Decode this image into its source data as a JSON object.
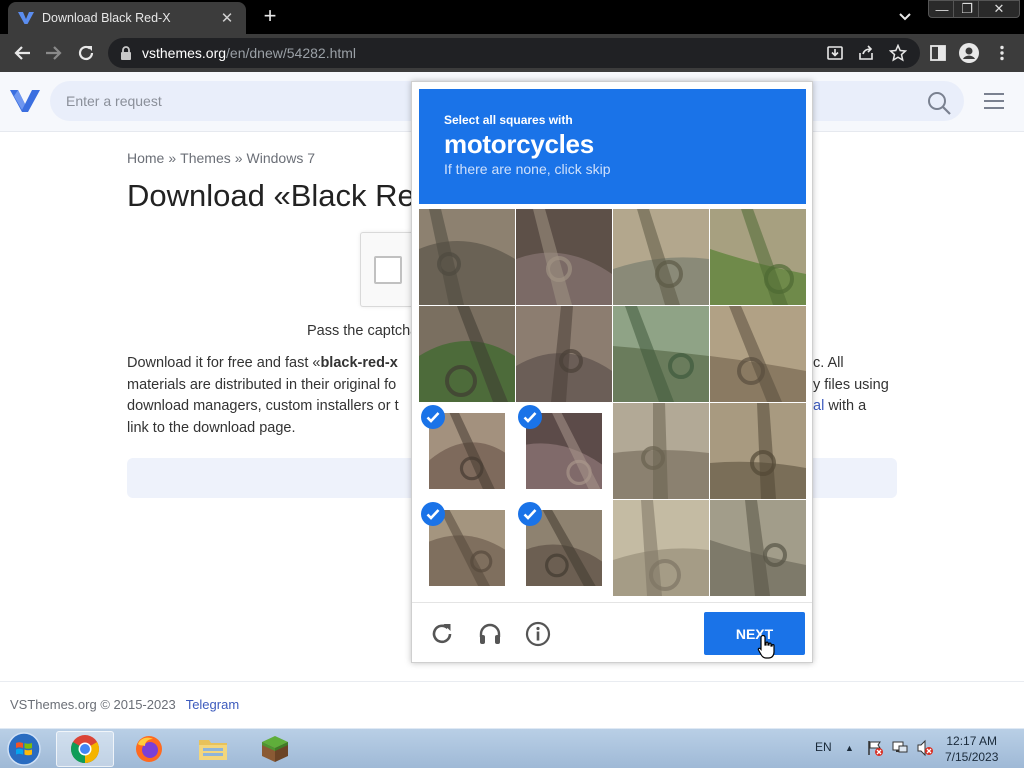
{
  "browser": {
    "tab_title": "Download Black Red-X",
    "tab_close": "✕",
    "new_tab": "+",
    "url_host": "vsthemes.org",
    "url_path": "/en/dnew/54282.html",
    "window_minimize": "—",
    "window_maximize": "❐",
    "window_close": "✕"
  },
  "site": {
    "search_placeholder": "Enter a request",
    "breadcrumb": [
      "Home",
      "Themes",
      "Windows 7"
    ],
    "breadcrumb_separator": "»",
    "title": "Download «Black Red-X»",
    "captcha_prompt": "Pass the captcha",
    "description_lines": [
      {
        "before": "Download it for free and fast «",
        "bold": "black-red-x",
        "after": ""
      },
      {
        "before": "materials are distributed in their original fo",
        "bold": "",
        "after": ""
      },
      {
        "before": "download managers, custom installers or t",
        "bold": "",
        "after": ""
      },
      {
        "before": "link to the download page.",
        "bold": "",
        "after": ""
      }
    ],
    "description_right": [
      {
        "text": "c. All",
        "link": ""
      },
      {
        "text": "y files using",
        "link": ""
      },
      {
        "text": " with a",
        "link": "al"
      }
    ],
    "footer_copyright": "VSThemes.org © 2015-2023",
    "footer_link": "Telegram"
  },
  "captcha": {
    "instruction": "Select all squares with",
    "object": "motorcycles",
    "hint": "If there are none, click skip",
    "selected_tiles": [
      8,
      9,
      12,
      13
    ],
    "next_label": "NEXT",
    "icons": [
      "reload-icon",
      "audio-icon",
      "info-icon"
    ]
  },
  "taskbar": {
    "apps": [
      "chrome",
      "firefox",
      "file-explorer",
      "minecraft"
    ],
    "active_app": "chrome",
    "language": "EN",
    "time": "12:17 AM",
    "date": "7/15/2023"
  },
  "colors": {
    "captcha_blue": "#1a73e8",
    "chrome_dark": "#3c3c3c",
    "link_blue": "#3d5bbd"
  }
}
